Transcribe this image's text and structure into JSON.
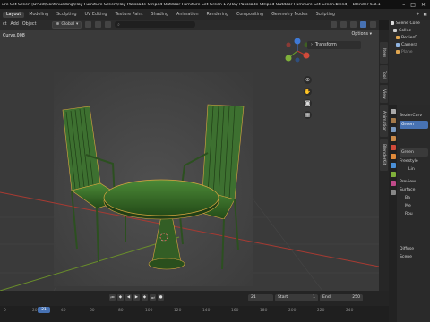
{
  "titlebar": {
    "title": "ure Set Green [D:\\3d\\Continueding\\Hay Furniture Green\\Hay Palissade Striped Outdoor Furniture Set Green 17\\Hay Palissade Striped Outdoor Furniture Set Green.blend] - Blender 5.0.1"
  },
  "menubar": {
    "tabs": [
      "Layout",
      "Modeling",
      "Sculpting",
      "UV Editing",
      "Texture Paint",
      "Shading",
      "Animation",
      "Rendering",
      "Compositing",
      "Geometry Nodes",
      "Scripting"
    ],
    "active_index": 0
  },
  "viewport_header": {
    "menus": [
      "ct",
      "Add",
      "Object"
    ],
    "orientation": "Global"
  },
  "viewport": {
    "object_name": "Curve.008",
    "options_label": "Options",
    "npanel_tab": "Transform"
  },
  "sidebar_tabs": [
    "Item",
    "Tool",
    "View",
    "Animation",
    "BlenderKit"
  ],
  "outliner": {
    "rows": [
      "Scene Colle",
      "Collec",
      "BezierC",
      "Camera",
      "Plane"
    ]
  },
  "properties": {
    "rows": [
      "BezierCurv",
      "Green",
      "Green",
      "Freestyle",
      "Lin",
      "Preview",
      "Surface",
      "Ba",
      "Me",
      "Rou",
      "Diffuse",
      "Scene"
    ]
  },
  "timeline": {
    "current_frame": "21",
    "start_label": "Start",
    "start_value": "1",
    "end_label": "End",
    "end_value": "250",
    "ticks": [
      "0",
      "20",
      "40",
      "60",
      "80",
      "100",
      "120",
      "140",
      "160",
      "180",
      "200",
      "220",
      "240"
    ],
    "playhead_label": "21"
  },
  "colors": {
    "chair_green": "#2f5a24",
    "chair_highlight": "#4e8a3a",
    "selection_outline": "#d9a640",
    "active_blue": "#4772b3",
    "axis_x": "#c0392b",
    "axis_y": "#5d8f1f"
  }
}
